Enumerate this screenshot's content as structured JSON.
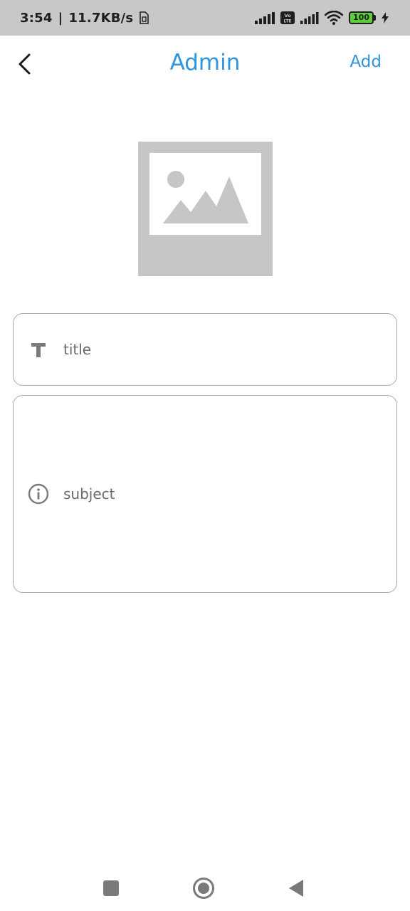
{
  "status_bar": {
    "time": "3:54",
    "separator": "|",
    "network_speed": "11.7KB/s",
    "battery_level": "100",
    "icons": [
      "sim-card-icon",
      "cell-signal-icon",
      "volte-icon",
      "cell-signal-icon",
      "wifi-icon",
      "battery-icon",
      "charging-icon"
    ]
  },
  "header": {
    "title": "Admin",
    "add_label": "Add",
    "back_icon": "back-arrow-icon",
    "accent_color": "#2f95dc"
  },
  "image_picker": {
    "icon": "image-placeholder-icon"
  },
  "form": {
    "title_placeholder": "title",
    "title_value": "",
    "title_icon": "text-format-icon",
    "subject_placeholder": "subject",
    "subject_value": "",
    "subject_icon": "info-icon"
  },
  "nav_bar": {
    "icons": [
      "recents-icon",
      "home-icon",
      "back-triangle-icon"
    ]
  }
}
